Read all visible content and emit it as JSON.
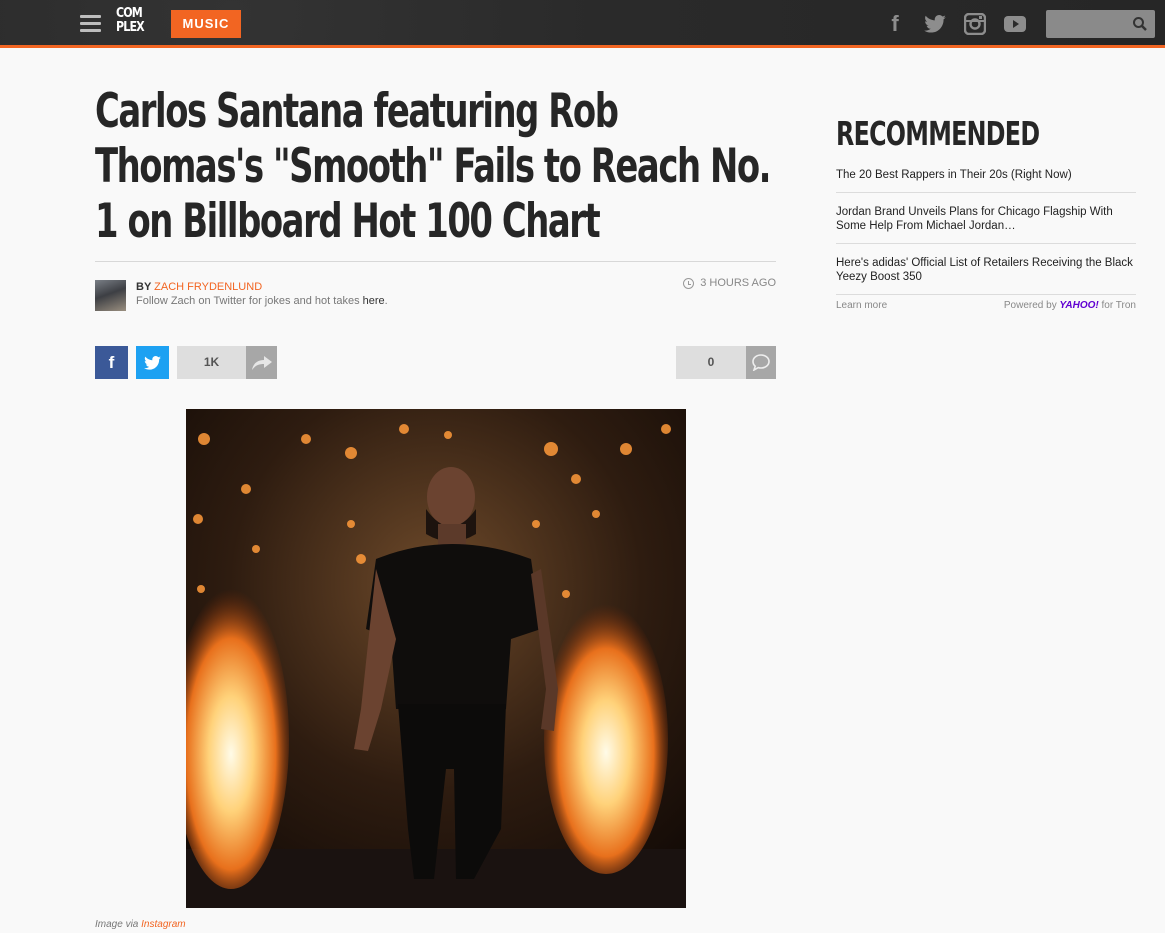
{
  "header": {
    "logo_line1": "COM",
    "logo_line2": "PLEX",
    "section": "MUSIC",
    "search_placeholder": "",
    "social_icons": [
      "facebook-icon",
      "twitter-icon",
      "instagram-icon",
      "youtube-icon"
    ],
    "accent_color": "#f26522"
  },
  "article": {
    "title": "Carlos Santana featuring Rob Thomas's \"Smooth\" Fails to Reach No. 1 on Billboard Hot 100 Chart",
    "by_label": "BY",
    "author": "ZACH FRYDENLUND",
    "follow_text": "Follow Zach on Twitter for jokes and hot takes",
    "follow_link": "here",
    "follow_period": ".",
    "timestamp": "3 HOURS AGO",
    "share_count": "1K",
    "comment_count": "0",
    "caption_prefix": "Image via",
    "caption_link": "Instagram"
  },
  "sidebar": {
    "title": "RECOMMENDED",
    "items": [
      "The 20 Best Rappers in Their 20s (Right Now)",
      "Jordan Brand Unveils Plans for Chicago Flagship With Some Help From Michael Jordan…",
      "Here's adidas' Official List of Retailers Receiving the Black Yeezy Boost 350"
    ],
    "learn_more": "Learn more",
    "powered_by": "Powered by",
    "yahoo": "YAHOO!",
    "for_tron": "for Tron"
  }
}
